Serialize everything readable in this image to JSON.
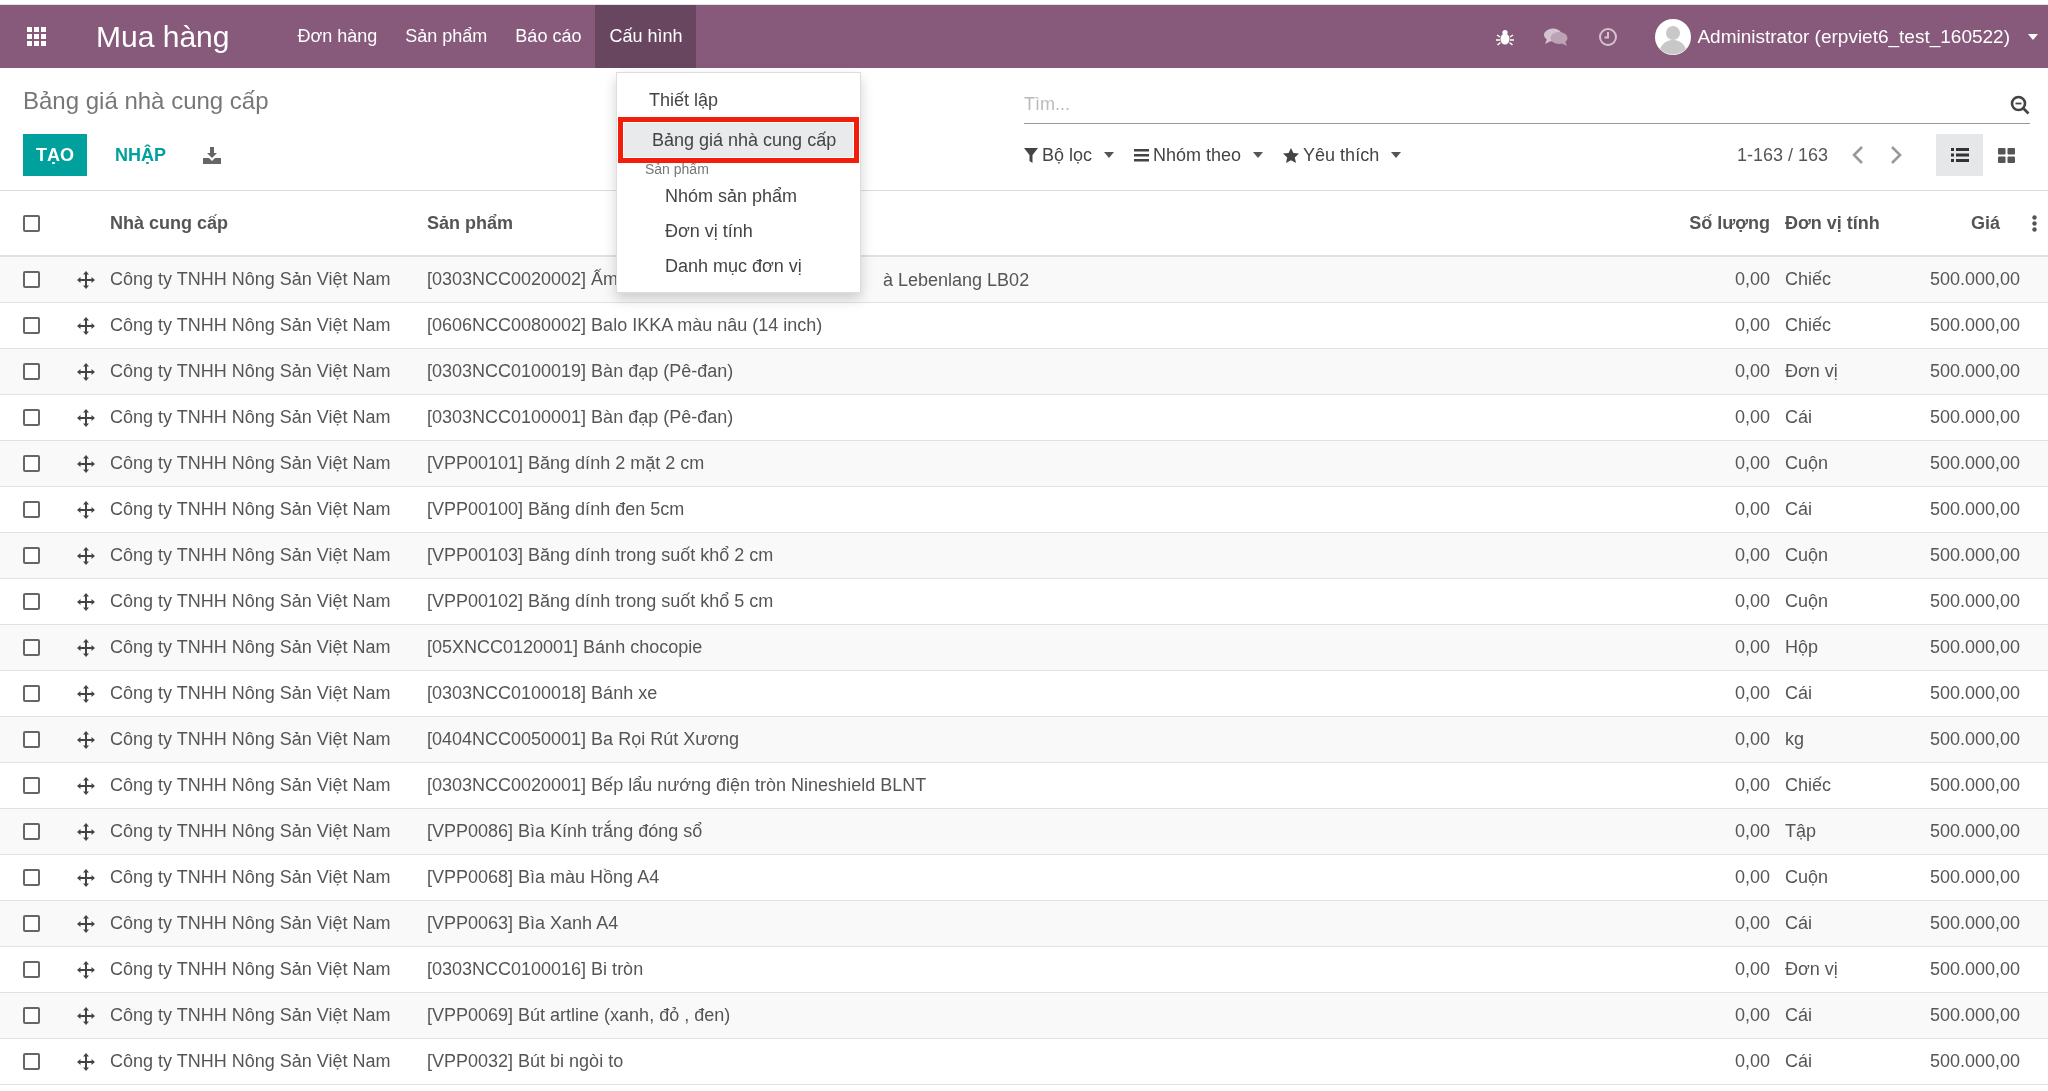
{
  "navbar": {
    "app_title": "Mua hàng",
    "menu": [
      {
        "label": "Đơn hàng",
        "selected": false
      },
      {
        "label": "Sản phẩm",
        "selected": false
      },
      {
        "label": "Báo cáo",
        "selected": false
      },
      {
        "label": "Cấu hình",
        "selected": true
      }
    ],
    "user": "Administrator (erpviet6_test_160522)"
  },
  "dropdown": {
    "items": [
      {
        "kind": "item",
        "label": "Thiết lập",
        "selected": false,
        "boxed": false
      },
      {
        "kind": "item",
        "label": "Bảng giá nhà cung cấp",
        "selected": true,
        "boxed": true
      },
      {
        "kind": "header",
        "label": "Sản phẩm"
      },
      {
        "kind": "subitem",
        "label": "Nhóm sản phẩm",
        "selected": false,
        "boxed": false
      },
      {
        "kind": "subitem",
        "label": "Đơn vị tính",
        "selected": false,
        "boxed": false
      },
      {
        "kind": "subitem",
        "label": "Danh mục đơn vị",
        "selected": false,
        "boxed": false
      }
    ]
  },
  "control_panel": {
    "title": "Bảng giá nhà cung cấp",
    "search": {
      "placeholder": "Tìm..."
    },
    "buttons": [
      "TẠO",
      "NHẬP"
    ],
    "filters": [
      "Bộ lọc",
      "Nhóm theo",
      "Yêu thích"
    ],
    "pager": "1-163 / 163",
    "views": [
      {
        "kind": "list",
        "selected": true
      },
      {
        "kind": "kanban",
        "selected": false
      }
    ]
  },
  "table": {
    "select_all": {
      "checked": false
    },
    "columns": [
      "Nhà cung cấp",
      "Sản phẩm",
      "Số lượng",
      "Đơn vị tính",
      "Giá"
    ],
    "rows": [
      {
        "checked": false,
        "supplier": "Công ty TNHH Nông Sản Việt Nam",
        "product": "[0303NCC0020002] Ấm",
        "product_tail": "à Lebenlang LB02",
        "quantity": "0,00",
        "unit": "Chiếc",
        "price": "500.000,00"
      },
      {
        "checked": false,
        "supplier": "Công ty TNHH Nông Sản Việt Nam",
        "product": "[0606NCC0080002] Balo IKKA màu nâu (14 inch)",
        "quantity": "0,00",
        "unit": "Chiếc",
        "price": "500.000,00"
      },
      {
        "checked": false,
        "supplier": "Công ty TNHH Nông Sản Việt Nam",
        "product": "[0303NCC0100019] Bàn đạp (Pê-đan)",
        "quantity": "0,00",
        "unit": "Đơn vị",
        "price": "500.000,00"
      },
      {
        "checked": false,
        "supplier": "Công ty TNHH Nông Sản Việt Nam",
        "product": "[0303NCC0100001] Bàn đạp (Pê-đan)",
        "quantity": "0,00",
        "unit": "Cái",
        "price": "500.000,00"
      },
      {
        "checked": false,
        "supplier": "Công ty TNHH Nông Sản Việt Nam",
        "product": "[VPP00101] Băng dính 2 mặt 2 cm",
        "quantity": "0,00",
        "unit": "Cuộn",
        "price": "500.000,00"
      },
      {
        "checked": false,
        "supplier": "Công ty TNHH Nông Sản Việt Nam",
        "product": "[VPP00100] Băng dính đen 5cm",
        "quantity": "0,00",
        "unit": "Cái",
        "price": "500.000,00"
      },
      {
        "checked": false,
        "supplier": "Công ty TNHH Nông Sản Việt Nam",
        "product": "[VPP00103] Băng dính trong suốt khổ 2 cm",
        "quantity": "0,00",
        "unit": "Cuộn",
        "price": "500.000,00"
      },
      {
        "checked": false,
        "supplier": "Công ty TNHH Nông Sản Việt Nam",
        "product": "[VPP00102] Băng dính trong suốt khổ 5 cm",
        "quantity": "0,00",
        "unit": "Cuộn",
        "price": "500.000,00"
      },
      {
        "checked": false,
        "supplier": "Công ty TNHH Nông Sản Việt Nam",
        "product": "[05XNCC0120001] Bánh chocopie",
        "quantity": "0,00",
        "unit": "Hộp",
        "price": "500.000,00"
      },
      {
        "checked": false,
        "supplier": "Công ty TNHH Nông Sản Việt Nam",
        "product": "[0303NCC0100018] Bánh xe",
        "quantity": "0,00",
        "unit": "Cái",
        "price": "500.000,00"
      },
      {
        "checked": false,
        "supplier": "Công ty TNHH Nông Sản Việt Nam",
        "product": "[0404NCC0050001] Ba Rọi Rút Xương",
        "quantity": "0,00",
        "unit": "kg",
        "price": "500.000,00"
      },
      {
        "checked": false,
        "supplier": "Công ty TNHH Nông Sản Việt Nam",
        "product": "[0303NCC0020001] Bếp lẩu nướng điện tròn Nineshield BLNT",
        "quantity": "0,00",
        "unit": "Chiếc",
        "price": "500.000,00"
      },
      {
        "checked": false,
        "supplier": "Công ty TNHH Nông Sản Việt Nam",
        "product": "[VPP0086] Bìa Kính trắng đóng sổ",
        "quantity": "0,00",
        "unit": "Tập",
        "price": "500.000,00"
      },
      {
        "checked": false,
        "supplier": "Công ty TNHH Nông Sản Việt Nam",
        "product": "[VPP0068] Bìa màu Hồng A4",
        "quantity": "0,00",
        "unit": "Cuộn",
        "price": "500.000,00"
      },
      {
        "checked": false,
        "supplier": "Công ty TNHH Nông Sản Việt Nam",
        "product": "[VPP0063] Bìa Xanh A4",
        "quantity": "0,00",
        "unit": "Cái",
        "price": "500.000,00"
      },
      {
        "checked": false,
        "supplier": "Công ty TNHH Nông Sản Việt Nam",
        "product": "[0303NCC0100016] Bi tròn",
        "quantity": "0,00",
        "unit": "Đơn vị",
        "price": "500.000,00"
      },
      {
        "checked": false,
        "supplier": "Công ty TNHH Nông Sản Việt Nam",
        "product": "[VPP0069] Bút artline (xanh, đỏ , đen)",
        "quantity": "0,00",
        "unit": "Cái",
        "price": "500.000,00"
      },
      {
        "checked": false,
        "supplier": "Công ty TNHH Nông Sản Việt Nam",
        "product": "[VPP0032] Bút bi ngòi to",
        "quantity": "0,00",
        "unit": "Cái",
        "price": "500.000,00"
      }
    ]
  }
}
